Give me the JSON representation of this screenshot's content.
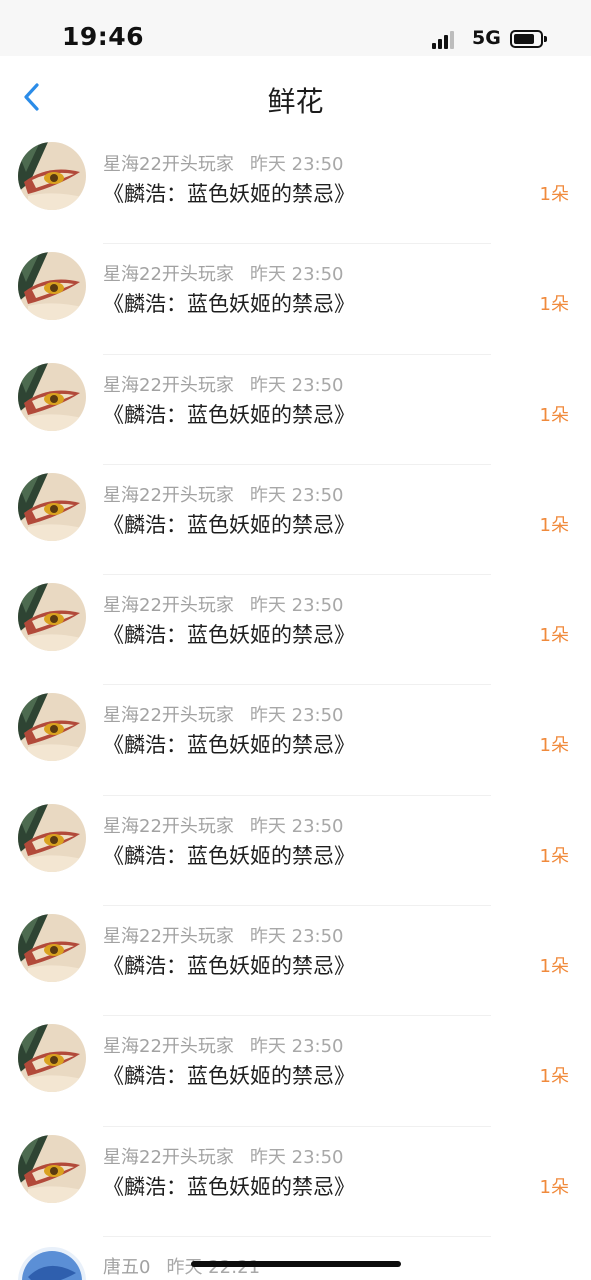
{
  "status_bar": {
    "time": "19:46",
    "network": "5G",
    "icons": [
      "signal-icon",
      "battery-icon"
    ]
  },
  "header": {
    "title": "鲜花",
    "back_icon": "chevron-left-icon",
    "accent_color": "#2b8ce8"
  },
  "items": [
    {
      "name": "星海22开头玩家",
      "time": "昨天 23:50",
      "title": "《麟浩：蓝色妖姬的禁忌》",
      "count": "1朵"
    },
    {
      "name": "星海22开头玩家",
      "time": "昨天 23:50",
      "title": "《麟浩：蓝色妖姬的禁忌》",
      "count": "1朵"
    },
    {
      "name": "星海22开头玩家",
      "time": "昨天 23:50",
      "title": "《麟浩：蓝色妖姬的禁忌》",
      "count": "1朵"
    },
    {
      "name": "星海22开头玩家",
      "time": "昨天 23:50",
      "title": "《麟浩：蓝色妖姬的禁忌》",
      "count": "1朵"
    },
    {
      "name": "星海22开头玩家",
      "time": "昨天 23:50",
      "title": "《麟浩：蓝色妖姬的禁忌》",
      "count": "1朵"
    },
    {
      "name": "星海22开头玩家",
      "time": "昨天 23:50",
      "title": "《麟浩：蓝色妖姬的禁忌》",
      "count": "1朵"
    },
    {
      "name": "星海22开头玩家",
      "time": "昨天 23:50",
      "title": "《麟浩：蓝色妖姬的禁忌》",
      "count": "1朵"
    },
    {
      "name": "星海22开头玩家",
      "time": "昨天 23:50",
      "title": "《麟浩：蓝色妖姬的禁忌》",
      "count": "1朵"
    },
    {
      "name": "星海22开头玩家",
      "time": "昨天 23:50",
      "title": "《麟浩：蓝色妖姬的禁忌》",
      "count": "1朵"
    },
    {
      "name": "星海22开头玩家",
      "time": "昨天 23:50",
      "title": "《麟浩：蓝色妖姬的禁忌》",
      "count": "1朵"
    }
  ],
  "last_item": {
    "name": "唐五0",
    "time": "昨天 22:21"
  },
  "colors": {
    "count": "#f08a3c",
    "meta_text": "#a2a2a2"
  }
}
